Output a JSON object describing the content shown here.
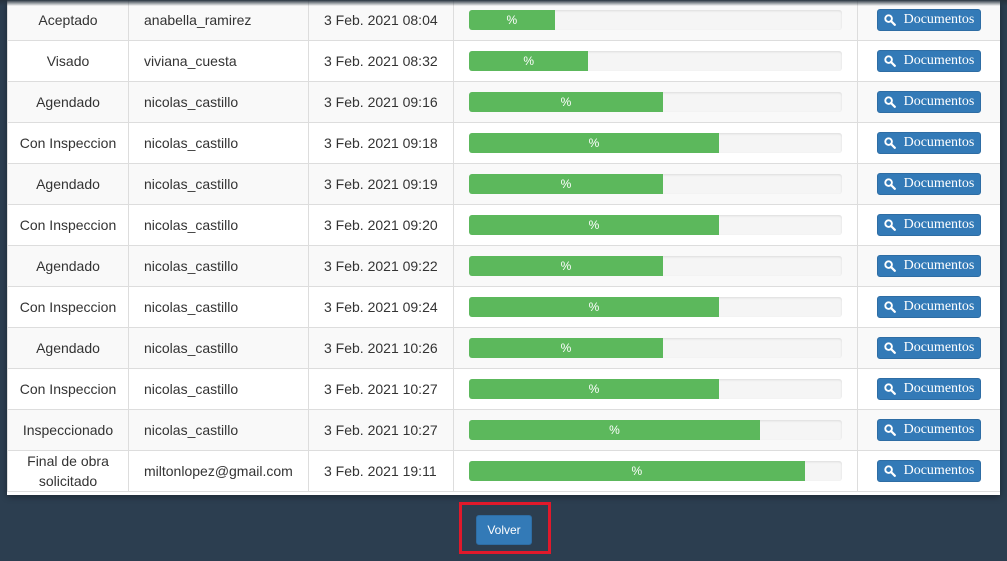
{
  "colors": {
    "progress": "#5cb85c",
    "button": "#337ab7",
    "background": "#2c3e50",
    "highlight": "#e0192b"
  },
  "table": {
    "rows": [
      {
        "state": "Aceptado",
        "user": "anabella_ramirez",
        "date": "3 Feb. 2021 08:04",
        "progress_label": "%",
        "progress": 0.23,
        "action_label": "Documentos"
      },
      {
        "state": "Visado",
        "user": "viviana_cuesta",
        "date": "3 Feb. 2021 08:32",
        "progress_label": "%",
        "progress": 0.32,
        "action_label": "Documentos"
      },
      {
        "state": "Agendado",
        "user": "nicolas_castillo",
        "date": "3 Feb. 2021 09:16",
        "progress_label": "%",
        "progress": 0.52,
        "action_label": "Documentos"
      },
      {
        "state": "Con Inspeccion",
        "user": "nicolas_castillo",
        "date": "3 Feb. 2021 09:18",
        "progress_label": "%",
        "progress": 0.67,
        "action_label": "Documentos"
      },
      {
        "state": "Agendado",
        "user": "nicolas_castillo",
        "date": "3 Feb. 2021 09:19",
        "progress_label": "%",
        "progress": 0.52,
        "action_label": "Documentos"
      },
      {
        "state": "Con Inspeccion",
        "user": "nicolas_castillo",
        "date": "3 Feb. 2021 09:20",
        "progress_label": "%",
        "progress": 0.67,
        "action_label": "Documentos"
      },
      {
        "state": "Agendado",
        "user": "nicolas_castillo",
        "date": "3 Feb. 2021 09:22",
        "progress_label": "%",
        "progress": 0.52,
        "action_label": "Documentos"
      },
      {
        "state": "Con Inspeccion",
        "user": "nicolas_castillo",
        "date": "3 Feb. 2021 09:24",
        "progress_label": "%",
        "progress": 0.67,
        "action_label": "Documentos"
      },
      {
        "state": "Agendado",
        "user": "nicolas_castillo",
        "date": "3 Feb. 2021 10:26",
        "progress_label": "%",
        "progress": 0.52,
        "action_label": "Documentos"
      },
      {
        "state": "Con Inspeccion",
        "user": "nicolas_castillo",
        "date": "3 Feb. 2021 10:27",
        "progress_label": "%",
        "progress": 0.67,
        "action_label": "Documentos"
      },
      {
        "state": "Inspeccionado",
        "user": "nicolas_castillo",
        "date": "3 Feb. 2021 10:27",
        "progress_label": "%",
        "progress": 0.78,
        "action_label": "Documentos"
      },
      {
        "state": "Final de obra solicitado",
        "user": "miltonlopez@gmail.com",
        "date": "3 Feb. 2021 19:11",
        "progress_label": "%",
        "progress": 0.9,
        "action_label": "Documentos"
      }
    ]
  },
  "footer": {
    "back_label": "Volver"
  }
}
